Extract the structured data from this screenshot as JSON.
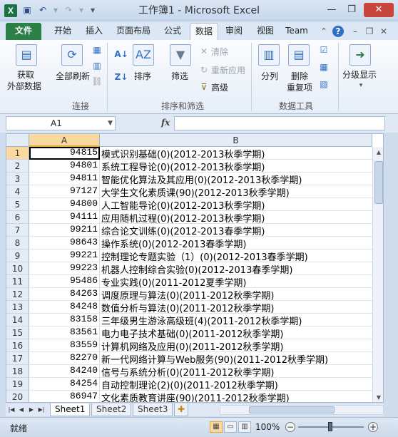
{
  "window": {
    "title": "工作簿1 - Microsoft Excel",
    "minimize": "—",
    "restore": "❐",
    "close": "✕"
  },
  "qat": {
    "excel_icon": "X",
    "save_icon": "💾",
    "undo_icon": "↶",
    "redo_icon": "↷",
    "customize_icon": "▾"
  },
  "tabs": [
    {
      "label": "文件"
    },
    {
      "label": "开始"
    },
    {
      "label": "插入"
    },
    {
      "label": "页面布局"
    },
    {
      "label": "公式"
    },
    {
      "label": "数据"
    },
    {
      "label": "审阅"
    },
    {
      "label": "视图"
    },
    {
      "label": "Team"
    }
  ],
  "ribbon": {
    "get_external_data_line1": "获取",
    "get_external_data_line2": "外部数据",
    "refresh_all": "全部刷新",
    "connections_group": "连接",
    "sort": "排序",
    "filter": "筛选",
    "clear": "清除",
    "reapply": "重新应用",
    "advanced": "高级",
    "sort_filter_group": "排序和筛选",
    "split": "分列",
    "remove_dup_line1": "删除",
    "remove_dup_line2": "重复项",
    "data_tools_group": "数据工具",
    "outline": "分级显示"
  },
  "formula_bar": {
    "name_box": "A1",
    "fx": "fx",
    "formula": ""
  },
  "columns": [
    "A",
    "B"
  ],
  "rows": [
    {
      "n": "1",
      "a": "94815",
      "b": "模式识别基础(0)(2012-2013秋季学期)"
    },
    {
      "n": "2",
      "a": "94801",
      "b": "系统工程导论(0)(2012-2013秋季学期)"
    },
    {
      "n": "3",
      "a": "94811",
      "b": "智能优化算法及其应用(0)(2012-2013秋季学期)"
    },
    {
      "n": "4",
      "a": "97127",
      "b": "大学生文化素质课(90)(2012-2013秋季学期)"
    },
    {
      "n": "5",
      "a": "94800",
      "b": "人工智能导论(0)(2012-2013秋季学期)"
    },
    {
      "n": "6",
      "a": "94111",
      "b": "应用随机过程(0)(2012-2013秋季学期)"
    },
    {
      "n": "7",
      "a": "99211",
      "b": "综合论文训练(0)(2012-2013春季学期)"
    },
    {
      "n": "8",
      "a": "98643",
      "b": "操作系统(0)(2012-2013春季学期)"
    },
    {
      "n": "9",
      "a": "99221",
      "b": "控制理论专题实验（1）(0)(2012-2013春季学期)"
    },
    {
      "n": "10",
      "a": "99223",
      "b": "机器人控制综合实验(0)(2012-2013春季学期)"
    },
    {
      "n": "11",
      "a": "95486",
      "b": "专业实践(0)(2011-2012夏季学期)"
    },
    {
      "n": "12",
      "a": "84263",
      "b": "调度原理与算法(0)(2011-2012秋季学期)"
    },
    {
      "n": "13",
      "a": "84248",
      "b": "数值分析与算法(0)(2011-2012秋季学期)"
    },
    {
      "n": "14",
      "a": "83158",
      "b": "三年级男生游泳高级班(4)(2011-2012秋季学期)"
    },
    {
      "n": "15",
      "a": "83561",
      "b": "电力电子技术基础(0)(2011-2012秋季学期)"
    },
    {
      "n": "16",
      "a": "83559",
      "b": "计算机网络及应用(0)(2011-2012秋季学期)"
    },
    {
      "n": "17",
      "a": "82270",
      "b": "新一代网络计算与Web服务(90)(2011-2012秋季学期)"
    },
    {
      "n": "18",
      "a": "84240",
      "b": "信号与系统分析(0)(2011-2012秋季学期)"
    },
    {
      "n": "19",
      "a": "84254",
      "b": "自动控制理论(2)(0)(2011-2012秋季学期)"
    },
    {
      "n": "20",
      "a": "86947",
      "b": "文化素质教育讲座(90)(2011-2012秋季学期)"
    }
  ],
  "sheets": [
    "Sheet1",
    "Sheet2",
    "Sheet3"
  ],
  "status": {
    "ready": "就绪",
    "zoom": "100%",
    "zoom_minus": "−",
    "zoom_plus": "+"
  },
  "colors": {
    "file_tab": "#2a8047",
    "selected_header": "#f9d99f",
    "close_button": "#c9463d"
  }
}
